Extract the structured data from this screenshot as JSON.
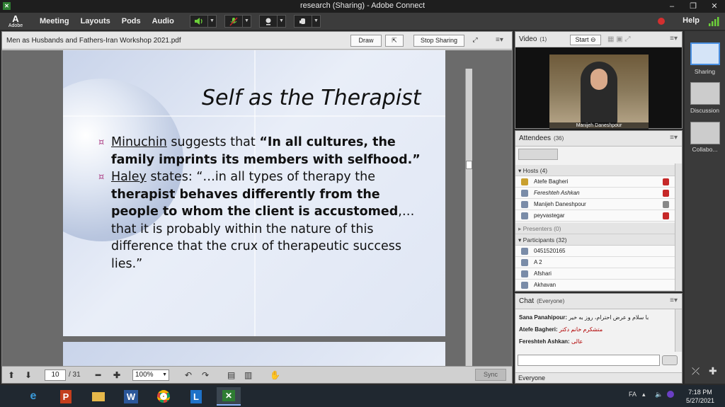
{
  "window": {
    "title": "research (Sharing) - Adobe Connect",
    "min": "–",
    "max": "❐",
    "close": "✕"
  },
  "menubar": {
    "logo_mark": "A",
    "logo_text": "Adobe",
    "items": [
      "Meeting",
      "Layouts",
      "Pods",
      "Audio"
    ],
    "help": "Help"
  },
  "share": {
    "doc_title": "Men as Husbands and Fathers-Iran Workshop 2021.pdf",
    "draw_label": "Draw",
    "stop_label": "Stop Sharing",
    "menu_glyph": "≡▾",
    "page_current": "10",
    "page_total": "/ 31",
    "zoom": "100%",
    "sync_label": "Sync"
  },
  "slide": {
    "title": "Self as the Therapist",
    "b1_name": "Minuchin",
    "b1_mid": " suggests that ",
    "b1_quote": "“In all cultures, the family imprints its members with selfhood.”",
    "b2_name": "Haley",
    "b2_pre": " states: “…in all types of therapy the ",
    "b2_bold": "therapist behaves differently from the people to whom the client is accustomed",
    "b2_post": ",…that it is probably within the nature of this difference that the crux of therapeutic success lies.”",
    "bullet_glyph": "¤"
  },
  "video": {
    "title": "Video",
    "count": "(1)",
    "start_label": "Start",
    "speaker_name": "Manijeh Daneshpour",
    "menu_glyph": "≡▾"
  },
  "attendees": {
    "title": "Attendees",
    "count": "(36)",
    "hosts_label": "Hosts (4)",
    "hosts": [
      "Atefe Bagheri",
      "Fereshteh Ashkan",
      "Manijeh Daneshpour",
      "peyvastegar"
    ],
    "presenters_label": "Presenters (0)",
    "participants_label": "Participants (32)",
    "participants": [
      "0451520165",
      "A 2",
      "Afshari",
      "Akhavan"
    ],
    "menu_glyph": "≡▾"
  },
  "chat": {
    "title": "Chat",
    "scope": "(Everyone)",
    "messages": [
      {
        "from": "Sana Panahipour:",
        "text": "با سلام و عرض احترام، روز به خیر"
      },
      {
        "from": "Atefe Bagheri:",
        "text": "متشکرم خانم دکتر"
      },
      {
        "from": "Fereshteh Ashkan:",
        "text": "عالی"
      }
    ],
    "recipient": "Everyone",
    "menu_glyph": "≡▾"
  },
  "layouts": {
    "items": [
      "Sharing",
      "Discussion",
      "Collabo..."
    ]
  },
  "taskbar": {
    "lang": "FA",
    "time": "7:18 PM",
    "date": "5/27/2021"
  }
}
